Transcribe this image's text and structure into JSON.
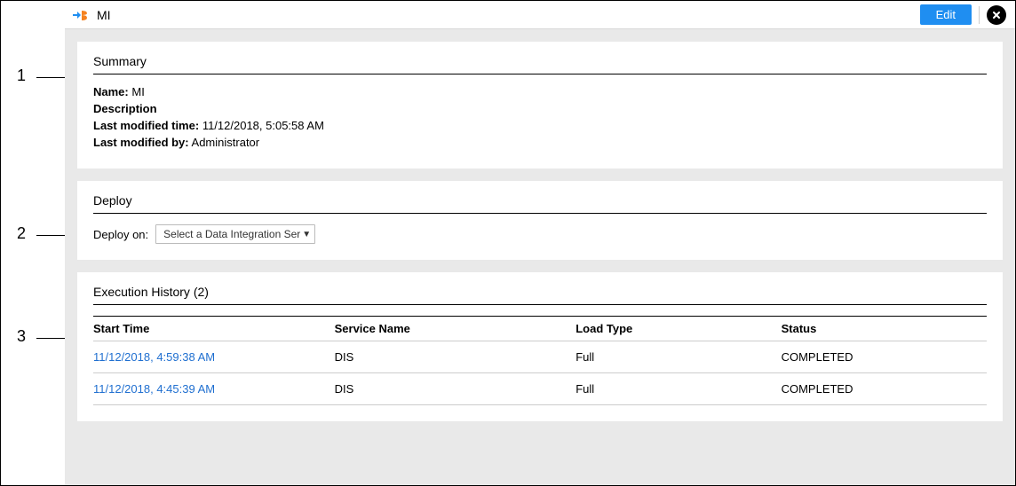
{
  "header": {
    "title": "MI",
    "edit_label": "Edit"
  },
  "summary": {
    "heading": "Summary",
    "name_label": "Name:",
    "name_value": "MI",
    "description_label": "Description",
    "description_value": "",
    "modified_time_label": "Last modified time:",
    "modified_time_value": "11/12/2018, 5:05:58 AM",
    "modified_by_label": "Last modified by:",
    "modified_by_value": "Administrator"
  },
  "deploy": {
    "heading": "Deploy",
    "deploy_on_label": "Deploy on:",
    "select_placeholder": "Select a Data Integration Ser"
  },
  "history": {
    "heading": "Execution History (2)",
    "columns": {
      "start_time": "Start Time",
      "service_name": "Service Name",
      "load_type": "Load Type",
      "status": "Status"
    },
    "rows": [
      {
        "start_time": "11/12/2018, 4:59:38 AM",
        "service_name": "DIS",
        "load_type": "Full",
        "status": "COMPLETED"
      },
      {
        "start_time": "11/12/2018, 4:45:39 AM",
        "service_name": "DIS",
        "load_type": "Full",
        "status": "COMPLETED"
      }
    ]
  },
  "callouts": {
    "one": "1",
    "two": "2",
    "three": "3"
  }
}
